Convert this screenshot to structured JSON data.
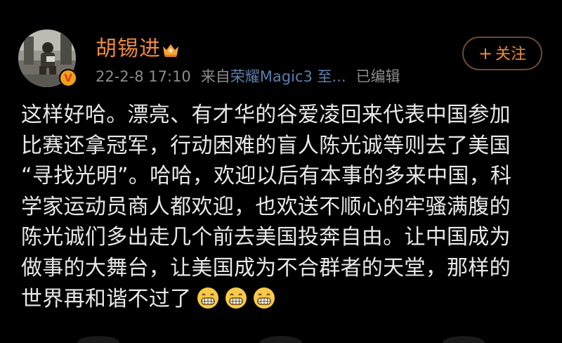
{
  "user": {
    "name": "胡锡进",
    "badge_icon": "vip-crown-icon",
    "verified_label": "V",
    "accent": "#ef8a3c",
    "verified_color": "#f0a21a"
  },
  "meta": {
    "timestamp": "22-2-8 17:10",
    "source_prefix": "来自",
    "source_device": "荣耀Magic3 至...",
    "edited": "已编辑"
  },
  "follow_button": {
    "icon": "plus-icon",
    "label": "关注"
  },
  "content": {
    "lines": [
      "这样好哈。漂亮、有才华的谷爱凌回来代表中国参加",
      "比赛还拿冠军，行动困难的盲人陈光诚等则去了美国",
      "“寻找光明”。哈哈，欢迎以后有本事的多来中国，科",
      "学家运动员商人都欢迎，也欢送不顺心的牢骚满腹的",
      "陈光诚们多出走几个前去美国投奔自由。让中国成为",
      "做事的大舞台，让美国成为不合群者的天堂，那样的",
      "世界再和谐不过了"
    ],
    "emojis": [
      "grin-emoji",
      "grin-emoji",
      "grin-emoji"
    ]
  }
}
